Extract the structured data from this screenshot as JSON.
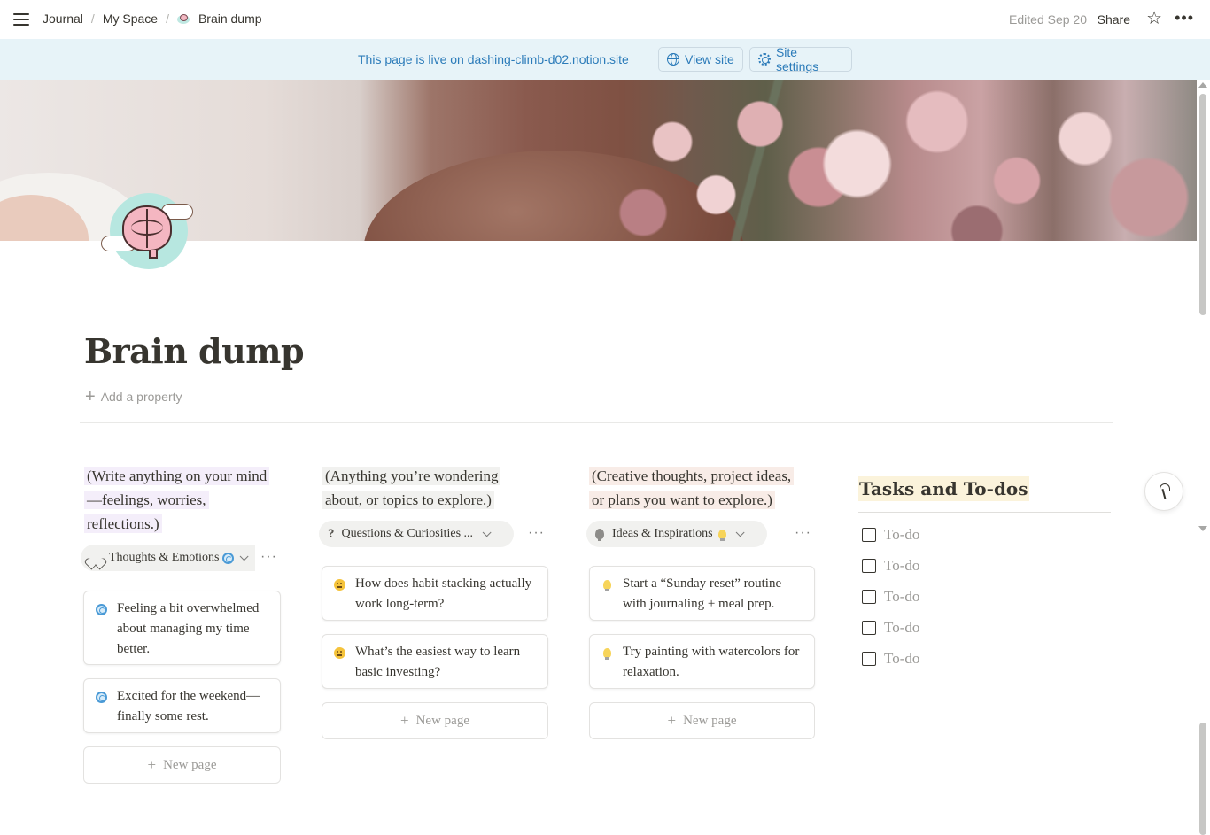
{
  "topbar": {
    "breadcrumbs": [
      "Journal",
      "My Space",
      "Brain dump"
    ],
    "edited": "Edited Sep 20",
    "share": "Share",
    "favorite_icon": "star-icon",
    "more_icon": "more-icon"
  },
  "banner": {
    "text": "This page is live on dashing-climb-d02.notion.site",
    "view_site": "View site",
    "site_settings": "Site settings"
  },
  "page": {
    "title": "Brain dump",
    "add_property": "Add a property"
  },
  "columns": [
    {
      "description": [
        "(Write anything on your mind",
        "—feelings, worries,",
        "reflections.)"
      ],
      "chip": "Thoughts & Emotions",
      "cards": [
        "Feeling a bit overwhelmed about managing my time better.",
        "Excited for the weekend—finally some rest."
      ],
      "new_page": "New page"
    },
    {
      "description": [
        "(Anything you’re wondering",
        "about, or topics to explore.)"
      ],
      "chip": "Questions & Curiosities ...",
      "cards": [
        "How does habit stacking actually work long-term?",
        "What’s the easiest way to learn basic investing?"
      ],
      "new_page": "New page"
    },
    {
      "description": [
        "(Creative thoughts, project ideas,",
        "or plans you want to explore.)"
      ],
      "chip": "Ideas & Inspirations",
      "cards": [
        "Start a “Sunday reset” routine with journaling + meal prep.",
        "Try painting with watercolors for relaxation."
      ],
      "new_page": "New page"
    }
  ],
  "tasks": {
    "title": "Tasks and To-dos",
    "items": [
      "To-do",
      "To-do",
      "To-do",
      "To-do",
      "To-do"
    ]
  },
  "colors": {
    "banner_bg": "#e7f3f8",
    "banner_text": "#2b7bb9",
    "highlight_purple": "#f4eefa",
    "highlight_gray": "#f1f1ef",
    "highlight_brown": "#f8ece7",
    "tasks_highlight": "#fbf3db"
  }
}
